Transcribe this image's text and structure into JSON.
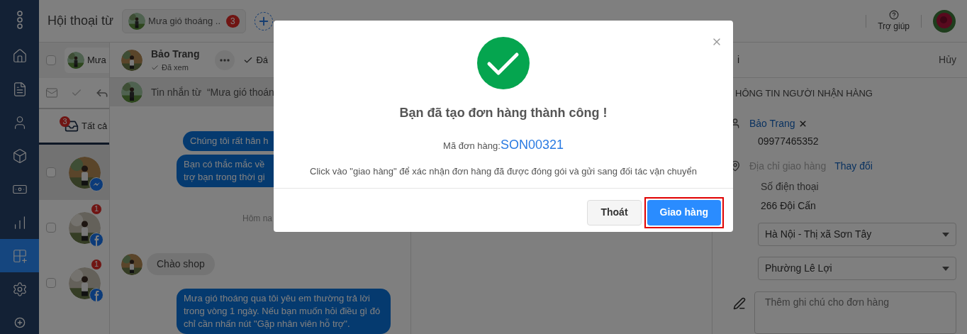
{
  "sidebar": {
    "items": [
      {
        "selected": false
      },
      {
        "selected": false
      },
      {
        "selected": false
      },
      {
        "selected": false
      },
      {
        "selected": false
      },
      {
        "selected": false
      },
      {
        "selected": true
      },
      {
        "selected": false
      }
    ]
  },
  "header": {
    "title": "Hội thoại từ",
    "page_tab": {
      "label": "Mưa gió thoáng ..",
      "badge": "3"
    },
    "help": "Trợ giúp"
  },
  "conversation_list": {
    "select_all_checked": false,
    "page_label": "Mưa",
    "filter_tab": {
      "label": "Tất cả",
      "badge": "3"
    },
    "rows": [
      {
        "selected": true,
        "checked": false,
        "kind": "messenger"
      },
      {
        "selected": false,
        "checked": false,
        "kind": "facebook",
        "badge": "1"
      },
      {
        "selected": false,
        "checked": false,
        "kind": "facebook",
        "badge": "1"
      }
    ]
  },
  "chat": {
    "contact": {
      "name": "Bảo Trang",
      "status": "Đã xem"
    },
    "action": "Đá",
    "banner": "Tin nhắn từ  “Mưa gió thoán",
    "messages": [
      {
        "kind": "out",
        "text": "Chúng tôi rất hân h"
      },
      {
        "kind": "out",
        "text": "Bạn có thắc mắc về\ntrợ bạn trong thời gi"
      },
      {
        "kind": "date",
        "text": "Hôm na"
      },
      {
        "kind": "in",
        "text": "Chào shop"
      },
      {
        "kind": "out",
        "text": "Mưa gió thoáng qua tôi yêu em thường trả lời trong vòng 1 ngày. Nếu bạn muốn hỏi điều gì đó chỉ cần nhấn nút \"Gặp nhân viên hỗ trợ\"."
      }
    ]
  },
  "order_panel": {
    "header": "i",
    "cancel": "Hủy",
    "section_title": "HÔNG TIN NGƯỜI NHẬN HÀNG",
    "customer_name": "Bảo Trang",
    "customer_phone": "09977465352",
    "address_label": "Địa chỉ giao hàng",
    "change_link": "Thay đổi",
    "phone_placeholder": "Số điện thoại",
    "address": "266 Đội Cấn",
    "selects": [
      "Hà Nội - Thị xã Sơn Tây",
      "Phường Lê Lợi"
    ],
    "note_placeholder": "Thêm ghi chú cho đơn hàng"
  },
  "modal": {
    "title": "Bạn đã tạo đơn hàng thành công !",
    "order_label": "Mã đơn hàng:",
    "order_code": "SON00321",
    "note": "Click vào \"giao hàng\" để xác nhận đơn hàng đã được đóng gói và gửi sang đối tác vận chuyển",
    "buttons": [
      {
        "label": "Thoát",
        "kind": "secondary",
        "highlighted": false
      },
      {
        "label": "Giao hàng",
        "kind": "primary",
        "highlighted": true
      }
    ]
  }
}
